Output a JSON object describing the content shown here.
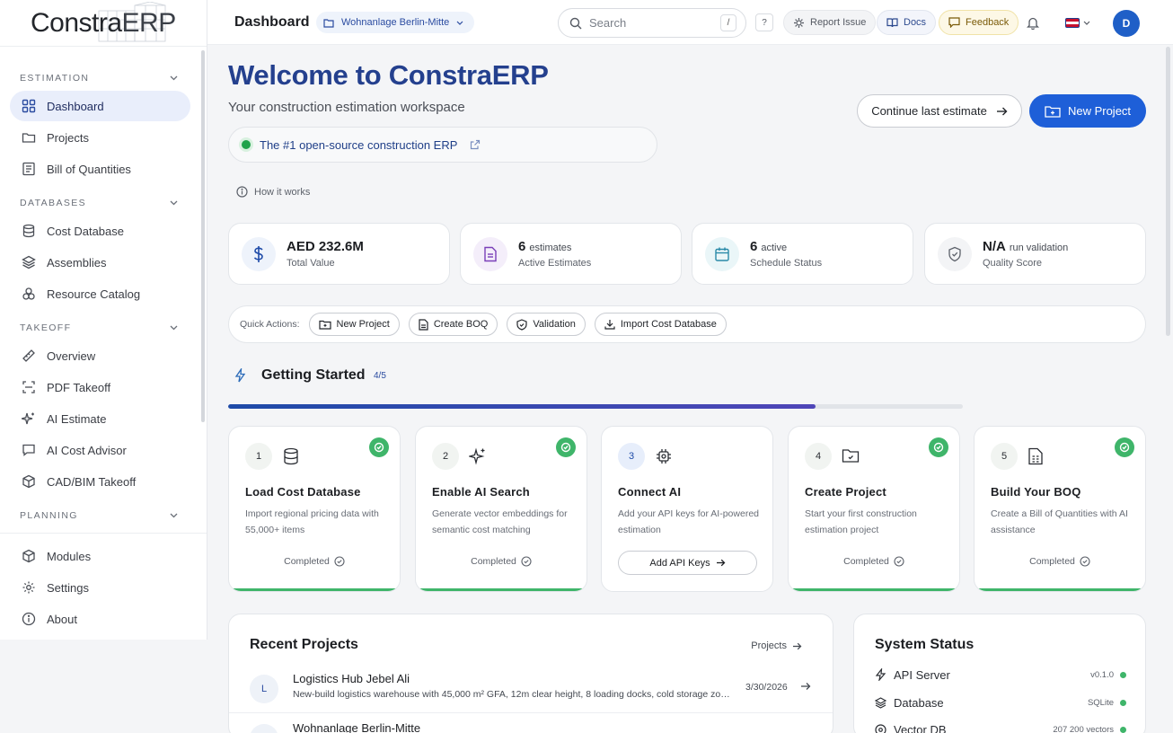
{
  "brand": {
    "name_prefix": "Constra",
    "name_suffix": "ERP"
  },
  "sidebar": {
    "sections": [
      {
        "label": "ESTIMATION",
        "items": [
          {
            "label": "Dashboard",
            "icon": "grid-icon",
            "active": true
          },
          {
            "label": "Projects",
            "icon": "folder-icon"
          },
          {
            "label": "Bill of Quantities",
            "icon": "table-icon"
          }
        ]
      },
      {
        "label": "DATABASES",
        "items": [
          {
            "label": "Cost Database",
            "icon": "database-icon"
          },
          {
            "label": "Assemblies",
            "icon": "layers-icon"
          },
          {
            "label": "Resource Catalog",
            "icon": "boxes-icon"
          }
        ]
      },
      {
        "label": "TAKEOFF",
        "items": [
          {
            "label": "Overview",
            "icon": "ruler-icon"
          },
          {
            "label": "PDF Takeoff",
            "icon": "scan-icon"
          },
          {
            "label": "AI Estimate",
            "icon": "sparkle-icon"
          },
          {
            "label": "AI Cost Advisor",
            "icon": "chat-icon"
          },
          {
            "label": "CAD/BIM Takeoff",
            "icon": "cube-icon"
          }
        ]
      },
      {
        "label": "PLANNING",
        "items": []
      }
    ],
    "bottom_items": [
      {
        "label": "Modules",
        "icon": "package-icon"
      },
      {
        "label": "Settings",
        "icon": "gear-icon"
      },
      {
        "label": "About",
        "icon": "info-icon"
      }
    ]
  },
  "topbar": {
    "title": "Dashboard",
    "project": "Wohnanlage Berlin-Mitte",
    "search_placeholder": "Search",
    "search_shortcut": "/",
    "help_label": "?",
    "report_label": "Report Issue",
    "docs_label": "Docs",
    "feedback_label": "Feedback",
    "avatar_initial": "D"
  },
  "hero": {
    "title": "Welcome to ConstraERP",
    "subtitle": "Your construction estimation workspace",
    "oss_tagline": "The #1 open-source construction ERP",
    "how_label": "How it works",
    "continue_label": "Continue last estimate",
    "new_project_label": "New Project"
  },
  "stats": [
    {
      "value": "AED 232.6M",
      "unit": "",
      "label": "Total Value",
      "icon": "dollar-icon",
      "color": "#eef3fb",
      "fg": "#1e4ba8"
    },
    {
      "value": "6",
      "unit": "estimates",
      "label": "Active Estimates",
      "icon": "document-icon",
      "color": "#f4eefa",
      "fg": "#7a3fb8"
    },
    {
      "value": "6",
      "unit": "active",
      "label": "Schedule Status",
      "icon": "calendar-icon",
      "color": "#eaf6f8",
      "fg": "#2a8aa8"
    },
    {
      "value": "N/A",
      "unit": "run validation",
      "label": "Quality Score",
      "icon": "shield-icon",
      "color": "#f3f4f6",
      "fg": "#5c616a"
    }
  ],
  "quick_actions": {
    "label": "Quick Actions:",
    "buttons": [
      {
        "label": "New Project",
        "icon": "folder-plus-icon"
      },
      {
        "label": "Create BOQ",
        "icon": "document-icon"
      },
      {
        "label": "Validation",
        "icon": "shield-check-icon"
      },
      {
        "label": "Import Cost Database",
        "icon": "download-icon"
      }
    ]
  },
  "getting_started": {
    "title": "Getting Started",
    "count": "4/5",
    "progress": 0.8,
    "steps": [
      {
        "num": "1",
        "title": "Load Cost Database",
        "desc": "Import regional pricing data with 55,000+ items",
        "status": "Completed",
        "done": true,
        "icon": "database-icon"
      },
      {
        "num": "2",
        "title": "Enable AI Search",
        "desc": "Generate vector embeddings for semantic cost matching",
        "status": "Completed",
        "done": true,
        "icon": "sparkle-icon"
      },
      {
        "num": "3",
        "title": "Connect AI",
        "desc": "Add your API keys for AI-powered estimation",
        "status": "",
        "done": false,
        "action": "Add API Keys",
        "icon": "chip-icon"
      },
      {
        "num": "4",
        "title": "Create Project",
        "desc": "Start your first construction estimation project",
        "status": "Completed",
        "done": true,
        "icon": "folder-icon"
      },
      {
        "num": "5",
        "title": "Build Your BOQ",
        "desc": "Create a Bill of Quantities with AI assistance",
        "status": "Completed",
        "done": true,
        "icon": "sheet-icon"
      }
    ]
  },
  "recent_projects": {
    "title": "Recent Projects",
    "link_label": "Projects",
    "items": [
      {
        "initial": "L",
        "name": "Logistics Hub Jebel Ali",
        "desc": "New-build logistics warehouse with 45,000 m² GFA, 12m clear height, 8 loading docks, cold storage zone...",
        "date": "3/30/2026"
      },
      {
        "initial": "W",
        "name": "Wohnanlage Berlin-Mitte",
        "desc": "",
        "date": ""
      }
    ]
  },
  "system_status": {
    "title": "System Status",
    "items": [
      {
        "label": "API Server",
        "value": "v0.1.0",
        "icon": "bolt-icon"
      },
      {
        "label": "Database",
        "value": "SQLite",
        "icon": "layers-icon"
      },
      {
        "label": "Vector DB",
        "value": "207 200 vectors",
        "icon": "network-icon"
      }
    ]
  }
}
